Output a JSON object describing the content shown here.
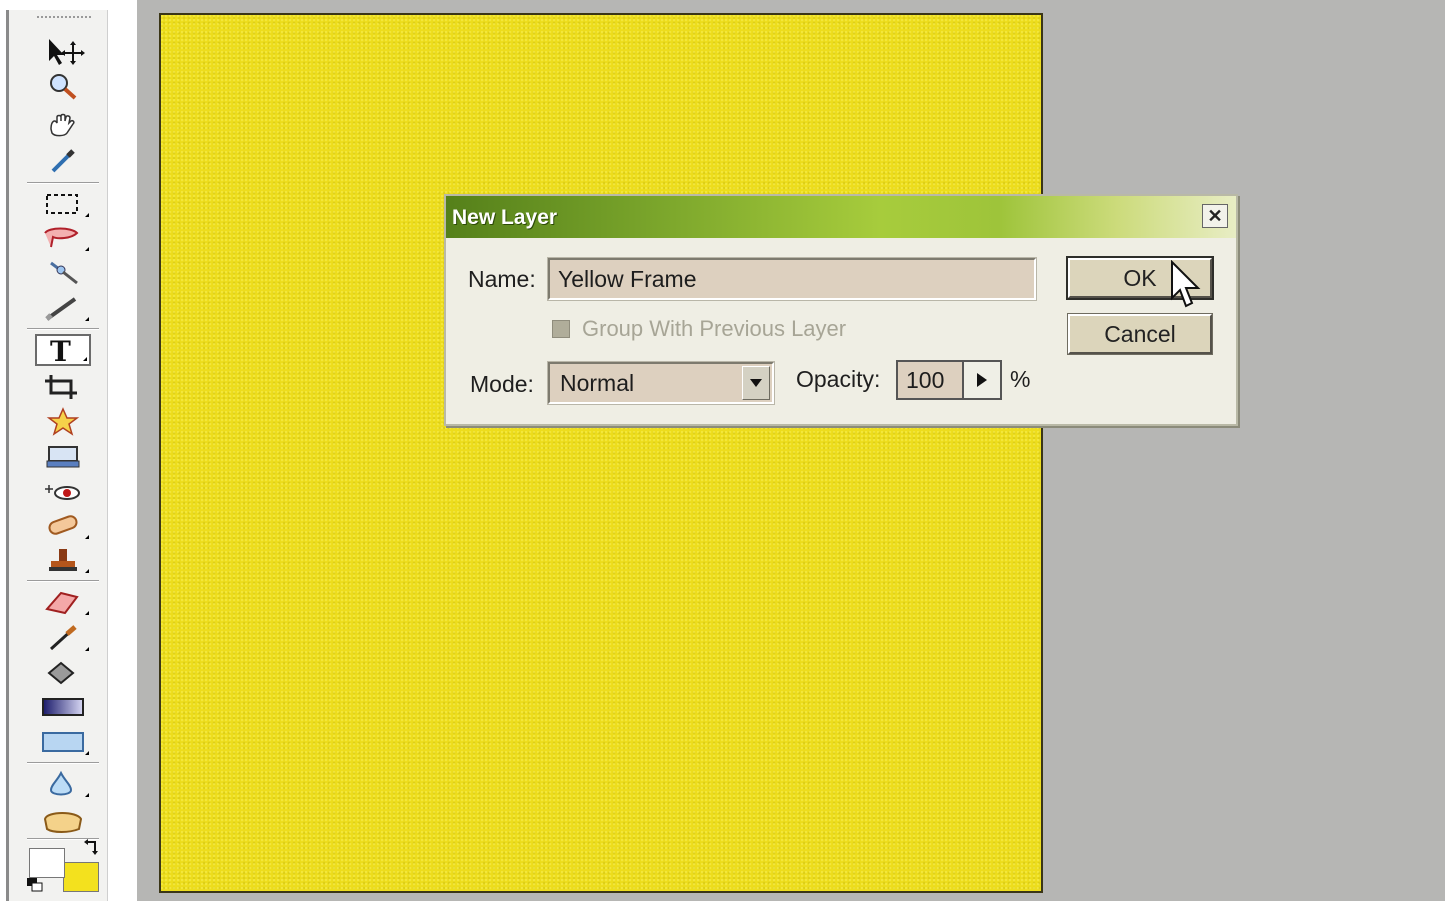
{
  "dialog": {
    "title": "New Layer",
    "close_glyph": "✕",
    "name_label": "Name:",
    "name_value": "Yellow Frame",
    "group_checkbox_label": "Group With Previous Layer",
    "group_checkbox_checked": false,
    "mode_label": "Mode:",
    "mode_value": "Normal",
    "opacity_label": "Opacity:",
    "opacity_value": "100",
    "percent_symbol": "%",
    "ok_label": "OK",
    "cancel_label": "Cancel"
  },
  "toolbox": {
    "tools": [
      "move-tool-icon",
      "zoom-tool-icon",
      "hand-tool-icon",
      "eyedropper-tool-icon",
      "rectangular-marquee-tool-icon",
      "lasso-tool-icon",
      "magic-wand-tool-icon",
      "selection-brush-tool-icon",
      "type-tool-icon",
      "crop-tool-icon",
      "custom-shape-tool-icon",
      "cookie-cutter-tool-icon",
      "red-eye-tool-icon",
      "healing-brush-tool-icon",
      "clone-stamp-tool-icon",
      "eraser-tool-icon",
      "brush-tool-icon",
      "paint-bucket-tool-icon",
      "gradient-tool-icon",
      "rectangle-shape-tool-icon",
      "blur-tool-icon",
      "sponge-tool-icon"
    ],
    "foreground_color": "#ffffff",
    "background_color": "#f3e11e"
  },
  "colors": {
    "canvas_fill": "#eddd1c",
    "workspace": "#b6b6b4",
    "titlebar_start": "#55801a",
    "titlebar_end": "#e8edc4"
  }
}
